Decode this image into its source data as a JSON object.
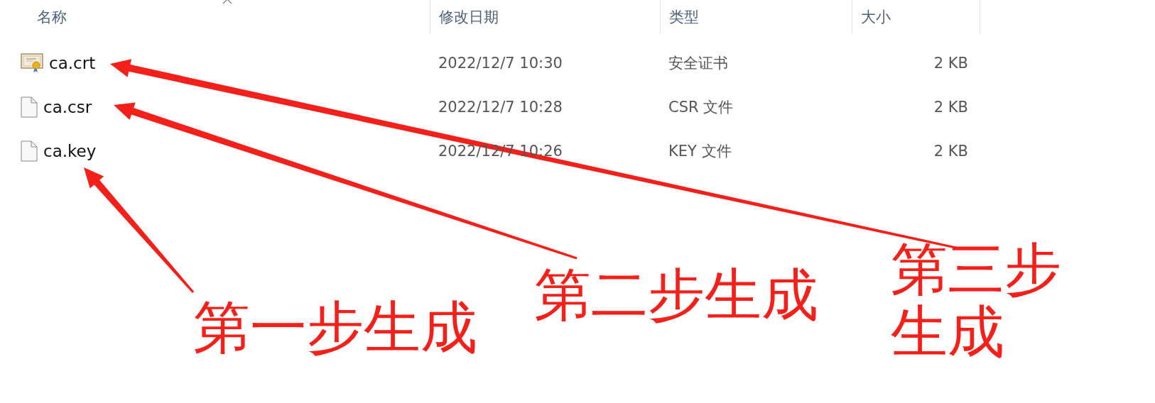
{
  "columns": [
    {
      "label": "名称"
    },
    {
      "label": "修改日期"
    },
    {
      "label": "类型"
    },
    {
      "label": "大小"
    }
  ],
  "files": [
    {
      "name": "ca.crt",
      "kind": "certificate",
      "modified": "2022/12/7 10:30",
      "type": "安全证书",
      "size": "2 KB"
    },
    {
      "name": "ca.csr",
      "kind": "file",
      "modified": "2022/12/7 10:28",
      "type": "CSR 文件",
      "size": "2 KB"
    },
    {
      "name": "ca.key",
      "kind": "file",
      "modified": "2022/12/7 10:26",
      "type": "KEY 文件",
      "size": "2 KB"
    }
  ],
  "annotations": [
    {
      "text": "第一步生成"
    },
    {
      "text": "第二步生成"
    },
    {
      "text": "第三步生成"
    }
  ]
}
